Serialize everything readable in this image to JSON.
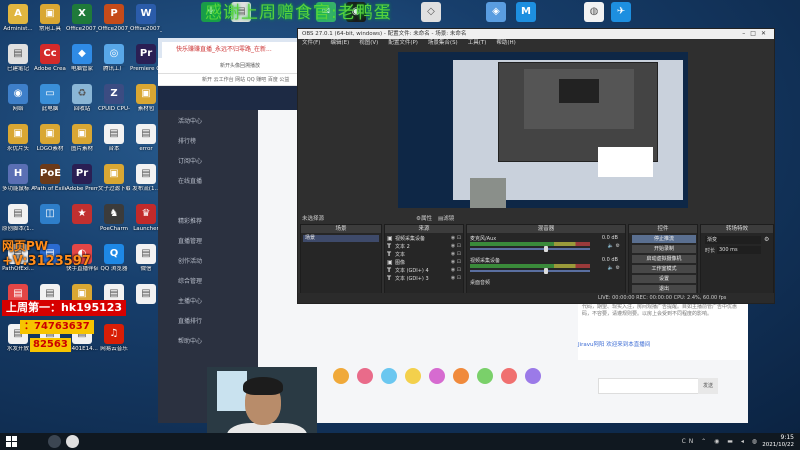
{
  "marquee": "感谢上周赠食官:老鸭蛋",
  "desktop_icons": [
    {
      "label": "Administ...",
      "color": "#e0b640",
      "glyph": "A"
    },
    {
      "label": "常用工具",
      "color": "#d9a733",
      "glyph": "▣"
    },
    {
      "label": "Office2007_Excel",
      "color": "#1f7a3a",
      "glyph": "X"
    },
    {
      "label": "Office2007_PPT",
      "color": "#c54b1a",
      "glyph": "P"
    },
    {
      "label": "Office2007_文档",
      "color": "#2b5caa",
      "glyph": "W"
    },
    {
      "label": "已建笔记",
      "color": "#e0e0e0",
      "glyph": "▤"
    },
    {
      "label": "Adobe Creati...",
      "color": "#d42a2a",
      "glyph": "Cc"
    },
    {
      "label": "电脑管家",
      "color": "#2f8be6",
      "glyph": "◆"
    },
    {
      "label": "腾讯工厂",
      "color": "#58a7e8",
      "glyph": "◎"
    },
    {
      "label": "Premiere CC2019",
      "color": "#2a1f54",
      "glyph": "Pr"
    },
    {
      "label": "网络",
      "color": "#3e7fc9",
      "glyph": "◉"
    },
    {
      "label": "此电脑",
      "color": "#3a8fd8",
      "glyph": "▭"
    },
    {
      "label": "回收站",
      "color": "#8ab6d6",
      "glyph": "♻"
    },
    {
      "label": "CPUID CPU-Z",
      "color": "#3b4c82",
      "glyph": "Z"
    },
    {
      "label": "素材包",
      "color": "#d9a733",
      "glyph": "▣"
    },
    {
      "label": "永优片头",
      "color": "#d9a733",
      "glyph": "▣"
    },
    {
      "label": "LOGO素材",
      "color": "#d9a733",
      "glyph": "▣"
    },
    {
      "label": "图片素材",
      "color": "#d9a733",
      "glyph": "▣"
    },
    {
      "label": "台本",
      "color": "#f2f2f2",
      "glyph": "▤"
    },
    {
      "label": "error",
      "color": "#f2f2f2",
      "glyph": "▤"
    },
    {
      "label": "多功能鼠标 AHK",
      "color": "#5a6fb4",
      "glyph": "H"
    },
    {
      "label": "Path of Exile",
      "color": "#6b3a1a",
      "glyph": "PoE"
    },
    {
      "label": "Adobe Premie...",
      "color": "#2a1f54",
      "glyph": "Pr"
    },
    {
      "label": "文子过滤下载 3.14.0(1...",
      "color": "#d9a733",
      "glyph": "▣"
    },
    {
      "label": "发布流(1...",
      "color": "#f2f2f2",
      "glyph": "▤"
    },
    {
      "label": "原创脚本(1...",
      "color": "#f2f2f2",
      "glyph": "▤"
    },
    {
      "label": "",
      "color": "#2e7ec9",
      "glyph": "◫"
    },
    {
      "label": "",
      "color": "#c13030",
      "glyph": "★"
    },
    {
      "label": "PoeCharm",
      "color": "#3b3b3b",
      "glyph": "♞"
    },
    {
      "label": "Launcher",
      "color": "#c22a2a",
      "glyph": "♛"
    },
    {
      "label": "PathOfExi...",
      "color": "#f2f2f2",
      "glyph": "▤"
    },
    {
      "label": "",
      "color": "#2b6bd0",
      "glyph": "▤"
    },
    {
      "label": "快手直播伴侣",
      "color": "#e34646",
      "glyph": "◐"
    },
    {
      "label": "QQ 浏览器",
      "color": "#1e88e5",
      "glyph": "Q"
    },
    {
      "label": "微信",
      "color": "#f2f2f2",
      "glyph": "▤"
    },
    {
      "label": "快手直播",
      "color": "#e34646",
      "glyph": "▤"
    },
    {
      "label": "新建文本文档(2)",
      "color": "#f2f2f2",
      "glyph": "▤"
    },
    {
      "label": "",
      "color": "#d9a733",
      "glyph": "▣"
    },
    {
      "label": "",
      "color": "#f2f2f2",
      "glyph": "▤"
    },
    {
      "label": "",
      "color": "#f2f2f2",
      "glyph": "▤"
    },
    {
      "label": "水发开放",
      "color": "#f2f2f2",
      "glyph": "▤"
    },
    {
      "label": "",
      "color": "#f2f2f2",
      "glyph": "▤"
    },
    {
      "label": "扫401E14...",
      "color": "#f2f2f2",
      "glyph": "▤"
    },
    {
      "label": "网易云音乐",
      "color": "#d81e06",
      "glyph": "♫"
    }
  ],
  "top_icons": [
    {
      "label": "",
      "color": "#1b9c4a",
      "glyph": "✚"
    },
    {
      "label": "",
      "color": "#e0e0e0",
      "glyph": "▤"
    },
    {
      "label": "",
      "color": "#36b06a",
      "glyph": "✉"
    },
    {
      "label": "",
      "color": "#1a1a1a",
      "glyph": "◉"
    },
    {
      "label": "",
      "color": "#e0e0e0",
      "glyph": "◇"
    },
    {
      "label": "",
      "color": "#5a9de0",
      "glyph": "◈"
    },
    {
      "label": "",
      "color": "#1d8fe0",
      "glyph": "M"
    },
    {
      "label": "",
      "color": "#f2f2f2",
      "glyph": "◍"
    },
    {
      "label": "",
      "color": "#1d8fe0",
      "glyph": "✈"
    }
  ],
  "browser": {
    "tab_title": "快乐赚赚直播_永远不归零路_在新...",
    "url": "新开头像回溯播放",
    "bookmarks": "新开  云工作台  网站  QQ  赚吧  百度  公益",
    "sidebar": [
      "活动中心",
      "排行榜",
      "订阅中心",
      "在线直播",
      "",
      "精彩推荐",
      "直播管理",
      "创作活动",
      "综合管理",
      "主播中心",
      "直播排行",
      "帮助中心"
    ],
    "chat_text": "代码，期望、现实入注，房间观播广告提醒。目如主播前管广告中优惠码，不容要，请遵规则要。以房上会受到不同程度的影响。",
    "notice": "Jiravu阿阳  欢迎来到本直播间",
    "send_label": "发送"
  },
  "obs": {
    "title": "OBS 27.0.1 (64-bit, windows) - 配置文件: 未命名 - 场景: 未命名",
    "menu": [
      "文件(F)",
      "编辑(E)",
      "视图(V)",
      "配置文件(P)",
      "场景集合(S)",
      "工具(T)",
      "帮助(H)"
    ],
    "no_source": "未选择源",
    "properties": "属性",
    "filters": "滤镜",
    "dock_titles": {
      "scenes": "场景",
      "sources": "来源",
      "mixer": "混音器",
      "controls": "控件",
      "transitions": "转场特效"
    },
    "scenes": [
      "场景"
    ],
    "sources": [
      {
        "type": "▣",
        "name": "视频采集设备"
      },
      {
        "type": "T",
        "name": "文本 2"
      },
      {
        "type": "T",
        "name": "文本"
      },
      {
        "type": "▣",
        "name": "图像"
      },
      {
        "type": "T",
        "name": "文本 (GDI+) 4"
      },
      {
        "type": "T",
        "name": "文本 (GDI+) 3"
      }
    ],
    "mixer": [
      {
        "name": "麦克风/Aux",
        "db": "0.0 dB",
        "level": 0.62
      },
      {
        "name": "视频采集设备",
        "db": "0.0 dB",
        "level": 0.62
      },
      {
        "name": "桌面音频",
        "db": "",
        "level": 0.0
      }
    ],
    "controls": [
      {
        "label": "停止推流",
        "active": true
      },
      {
        "label": "开始录制",
        "active": false
      },
      {
        "label": "启动虚拟摄像机",
        "active": false
      },
      {
        "label": "工作室模式",
        "active": false
      },
      {
        "label": "设置",
        "active": false
      },
      {
        "label": "退出",
        "active": false
      }
    ],
    "transition_type": "渐变",
    "duration_label": "时长",
    "duration_value": "300 ms",
    "status": "LIVE: 00:00:00   REC: 00:00:00   CPU: 2.4%, 60.00 fps"
  },
  "overlay": {
    "line1": "网页PW",
    "line2": "+V:3123597",
    "line3": "上周第一：hk195123",
    "line4": "：74763637",
    "line5": "82563"
  },
  "taskbar": {
    "tray": "CN ⌃ ◉ ▬ ◂ ◍",
    "time": "9:15",
    "date": "2021/10/22"
  },
  "colors": {
    "overlay_orange": "#ff8c1a",
    "marquee_green": "#58d23c",
    "obs_dark": "#3a3a3a",
    "desktop_blue": "#173e6b"
  }
}
